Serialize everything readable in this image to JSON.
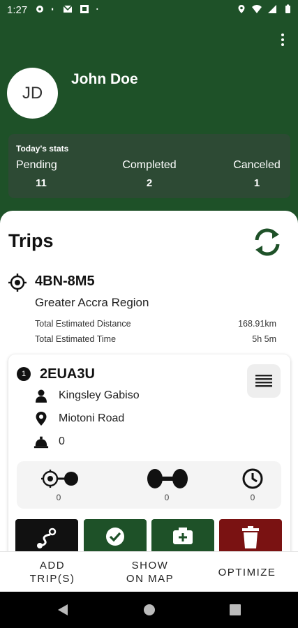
{
  "status_bar": {
    "time": "1:27",
    "left_icons": [
      "gear-icon",
      "dot-icon",
      "gmail-icon",
      "notification-icon",
      "dot-icon"
    ],
    "right_icons": [
      "location-icon",
      "wifi-icon",
      "signal-icon",
      "battery-icon"
    ]
  },
  "header": {
    "menu_icon": "kebab-menu-icon",
    "avatar_initials": "JD",
    "user_name": "John Doe"
  },
  "stats": {
    "title": "Today's stats",
    "items": [
      {
        "label": "Pending",
        "value": "11"
      },
      {
        "label": "Completed",
        "value": "2"
      },
      {
        "label": "Canceled",
        "value": "1"
      }
    ]
  },
  "trips": {
    "title": "Trips",
    "refresh_icon": "refresh-icon",
    "route": {
      "id": "4BN-8M5",
      "region": "Greater Accra Region",
      "metrics": [
        {
          "label": "Total Estimated Distance",
          "value": "168.91km"
        },
        {
          "label": "Total Estimated Time",
          "value": "5h 5m"
        }
      ]
    },
    "card": {
      "index": "1",
      "code": "2EUA3U",
      "driver": "Kingsley Gabiso",
      "location": "Miotoni Road",
      "bell_count": "0",
      "counts": [
        {
          "icon": "start-point-icon",
          "value": "0"
        },
        {
          "icon": "dumbbell-icon",
          "value": "0"
        },
        {
          "icon": "clock-icon",
          "value": "0"
        }
      ],
      "actions": [
        {
          "icon": "route-icon",
          "color": "#111111"
        },
        {
          "icon": "check-circle-icon",
          "color": "#1e5128"
        },
        {
          "icon": "camera-plus-icon",
          "color": "#1e5128"
        },
        {
          "icon": "trash-icon",
          "color": "#7a1212"
        }
      ]
    }
  },
  "bottom_bar": {
    "add_trips": "ADD\nTRIP(S)",
    "show_on_map": "SHOW\nON MAP",
    "optimize": "OPTIMIZE"
  },
  "nav_bar": {
    "back_icon": "back-triangle-icon",
    "home_icon": "home-circle-icon",
    "recents_icon": "recents-square-icon"
  },
  "colors": {
    "brand_green": "#1e5128",
    "stats_card": "#2d4a34",
    "danger_red": "#7a1212"
  }
}
